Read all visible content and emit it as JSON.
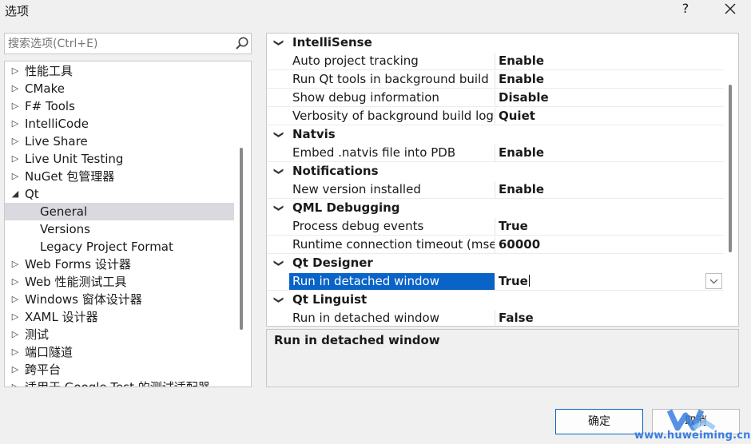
{
  "window": {
    "title": "选项",
    "help_label": "?",
    "close_icon": "close-icon"
  },
  "search": {
    "placeholder": "搜索选项(Ctrl+E)",
    "value": "",
    "icon": "search-icon"
  },
  "tree": {
    "items": [
      {
        "label": "性能工具",
        "expanded": false
      },
      {
        "label": "CMake",
        "expanded": false
      },
      {
        "label": "F# Tools",
        "expanded": false
      },
      {
        "label": "IntelliCode",
        "expanded": false
      },
      {
        "label": "Live Share",
        "expanded": false
      },
      {
        "label": "Live Unit Testing",
        "expanded": false
      },
      {
        "label": "NuGet 包管理器",
        "expanded": false
      },
      {
        "label": "Qt",
        "expanded": true
      },
      {
        "label": "General",
        "child": true,
        "selected": true
      },
      {
        "label": "Versions",
        "child": true
      },
      {
        "label": "Legacy Project Format",
        "child": true
      },
      {
        "label": "Web Forms 设计器",
        "expanded": false
      },
      {
        "label": "Web 性能测试工具",
        "expanded": false
      },
      {
        "label": "Windows 窗体设计器",
        "expanded": false
      },
      {
        "label": "XAML 设计器",
        "expanded": false
      },
      {
        "label": "测试",
        "expanded": false
      },
      {
        "label": "端口隧道",
        "expanded": false
      },
      {
        "label": "跨平台",
        "expanded": false
      },
      {
        "label": "适用于 Google Test 的测试适配器",
        "expanded": false
      }
    ]
  },
  "grid": {
    "rows": [
      {
        "type": "category",
        "name": "IntelliSense"
      },
      {
        "type": "prop",
        "name": "Auto project tracking",
        "value": "Enable"
      },
      {
        "type": "prop",
        "name": "Run Qt tools in background build",
        "value": "Enable"
      },
      {
        "type": "prop",
        "name": "Show debug information",
        "value": "Disable"
      },
      {
        "type": "prop",
        "name": "Verbosity of background build log",
        "value": "Quiet"
      },
      {
        "type": "category",
        "name": "Natvis"
      },
      {
        "type": "prop",
        "name": "Embed .natvis file into PDB",
        "value": "Enable"
      },
      {
        "type": "category",
        "name": "Notifications"
      },
      {
        "type": "prop",
        "name": "New version installed",
        "value": "Enable"
      },
      {
        "type": "category",
        "name": "QML Debugging"
      },
      {
        "type": "prop",
        "name": "Process debug events",
        "value": "True"
      },
      {
        "type": "prop",
        "name": "Runtime connection timeout (msec)",
        "value": "60000"
      },
      {
        "type": "category",
        "name": "Qt Designer"
      },
      {
        "type": "prop",
        "name": "Run in detached window",
        "value": "True",
        "selected": true
      },
      {
        "type": "category",
        "name": "Qt Linguist"
      },
      {
        "type": "prop",
        "name": "Run in detached window",
        "value": "False"
      }
    ]
  },
  "description": {
    "title": "Run in detached window"
  },
  "buttons": {
    "ok": "确定",
    "cancel": "取消"
  },
  "watermark": {
    "text": "www.huweiming.cn"
  },
  "colors": {
    "selection": "#0a64c8",
    "tree_selection": "#d9d9df"
  }
}
